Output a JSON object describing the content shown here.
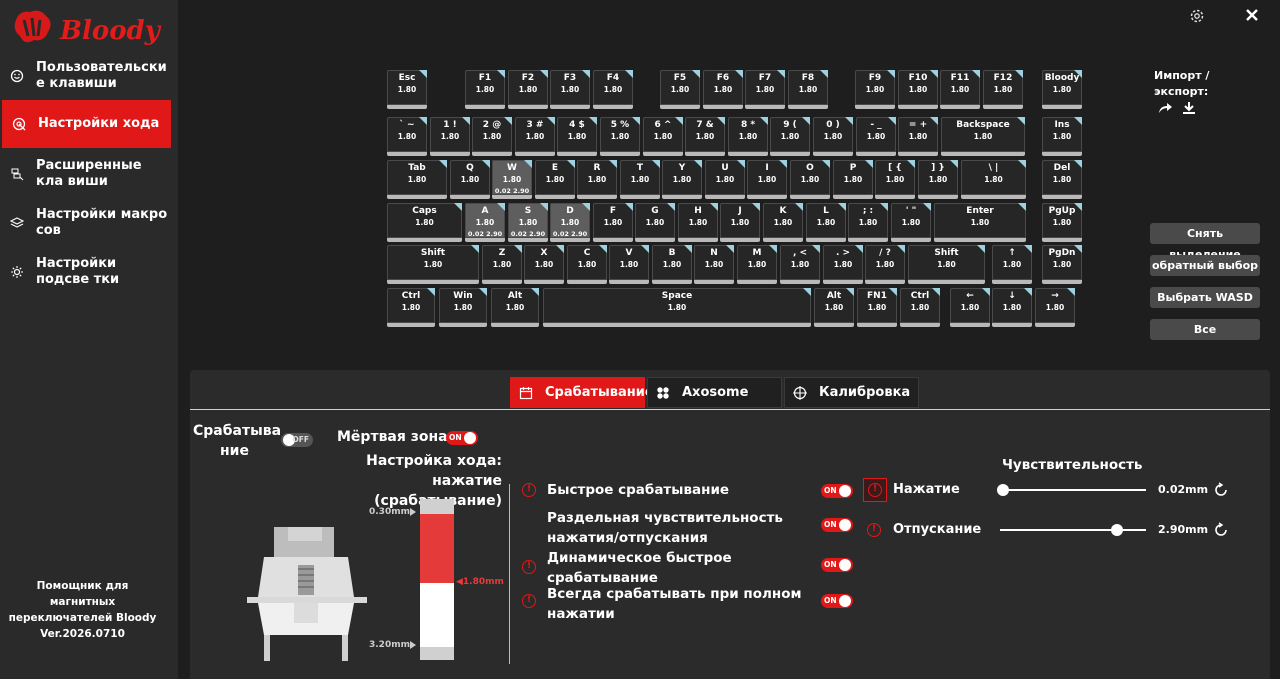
{
  "app": {
    "logo_text": "Bloody",
    "brand_color": "#e01818"
  },
  "sidebar": {
    "items": [
      {
        "label": "Пользовательски е клавиши",
        "icon": "smiley-icon"
      },
      {
        "label": "Настройки хода",
        "icon": "target-icon"
      },
      {
        "label": "Расширенные кла виши",
        "icon": "keys-icon"
      },
      {
        "label": "Настройки макро сов",
        "icon": "layers-icon"
      },
      {
        "label": "Настройки подсве тки",
        "icon": "sun-icon"
      }
    ],
    "helper": {
      "line1": "Помощник для",
      "line2": "магнитных",
      "line3": "переключателей Bloody",
      "version": "Ver.2026.0710"
    }
  },
  "window": {
    "settings_icon": "gear-icon",
    "close_icon": "close-icon"
  },
  "keyboard": {
    "default_value": "1.80",
    "rows": [
      [
        {
          "label": "Esc",
          "value": "1.80"
        },
        {
          "label": "F1",
          "value": "1.80"
        },
        {
          "label": "F2",
          "value": "1.80"
        },
        {
          "label": "F3",
          "value": "1.80"
        },
        {
          "label": "F4",
          "value": "1.80"
        },
        {
          "label": "F5",
          "value": "1.80"
        },
        {
          "label": "F6",
          "value": "1.80"
        },
        {
          "label": "F7",
          "value": "1.80"
        },
        {
          "label": "F8",
          "value": "1.80"
        },
        {
          "label": "F9",
          "value": "1.80"
        },
        {
          "label": "F10",
          "value": "1.80"
        },
        {
          "label": "F11",
          "value": "1.80"
        },
        {
          "label": "F12",
          "value": "1.80"
        },
        {
          "label": "Bloody",
          "value": "1.80"
        }
      ],
      [
        {
          "label": "` ~",
          "value": "1.80"
        },
        {
          "label": "1 !",
          "value": "1.80"
        },
        {
          "label": "2 @",
          "value": "1.80"
        },
        {
          "label": "3 #",
          "value": "1.80"
        },
        {
          "label": "4 $",
          "value": "1.80"
        },
        {
          "label": "5 %",
          "value": "1.80"
        },
        {
          "label": "6 ^",
          "value": "1.80"
        },
        {
          "label": "7 &",
          "value": "1.80"
        },
        {
          "label": "8 *",
          "value": "1.80"
        },
        {
          "label": "9 (",
          "value": "1.80"
        },
        {
          "label": "0 )",
          "value": "1.80"
        },
        {
          "label": "- _",
          "value": "1.80"
        },
        {
          "label": "= +",
          "value": "1.80"
        },
        {
          "label": "Backspace",
          "value": "1.80"
        },
        {
          "label": "Ins",
          "value": "1.80"
        }
      ],
      [
        {
          "label": "Tab",
          "value": "1.80"
        },
        {
          "label": "Q",
          "value": "1.80"
        },
        {
          "label": "W",
          "value": "1.80",
          "sub": "0.02  2.90",
          "selected": true
        },
        {
          "label": "E",
          "value": "1.80"
        },
        {
          "label": "R",
          "value": "1.80"
        },
        {
          "label": "T",
          "value": "1.80"
        },
        {
          "label": "Y",
          "value": "1.80"
        },
        {
          "label": "U",
          "value": "1.80"
        },
        {
          "label": "I",
          "value": "1.80"
        },
        {
          "label": "O",
          "value": "1.80"
        },
        {
          "label": "P",
          "value": "1.80"
        },
        {
          "label": "[ {",
          "value": "1.80"
        },
        {
          "label": "] }",
          "value": "1.80"
        },
        {
          "label": "\\ |",
          "value": "1.80"
        },
        {
          "label": "Del",
          "value": "1.80"
        }
      ],
      [
        {
          "label": "Caps",
          "value": "1.80"
        },
        {
          "label": "A",
          "value": "1.80",
          "sub": "0.02  2.90",
          "selected": true
        },
        {
          "label": "S",
          "value": "1.80",
          "sub": "0.02  2.90",
          "selected": true
        },
        {
          "label": "D",
          "value": "1.80",
          "sub": "0.02  2.90",
          "selected": true
        },
        {
          "label": "F",
          "value": "1.80"
        },
        {
          "label": "G",
          "value": "1.80"
        },
        {
          "label": "H",
          "value": "1.80"
        },
        {
          "label": "J",
          "value": "1.80"
        },
        {
          "label": "K",
          "value": "1.80"
        },
        {
          "label": "L",
          "value": "1.80"
        },
        {
          "label": "; :",
          "value": "1.80"
        },
        {
          "label": "' \"",
          "value": "1.80"
        },
        {
          "label": "Enter",
          "value": "1.80"
        },
        {
          "label": "PgUp",
          "value": "1.80"
        }
      ],
      [
        {
          "label": "Shift",
          "value": "1.80"
        },
        {
          "label": "Z",
          "value": "1.80"
        },
        {
          "label": "X",
          "value": "1.80"
        },
        {
          "label": "C",
          "value": "1.80"
        },
        {
          "label": "V",
          "value": "1.80"
        },
        {
          "label": "B",
          "value": "1.80"
        },
        {
          "label": "N",
          "value": "1.80"
        },
        {
          "label": "M",
          "value": "1.80"
        },
        {
          "label": ", <",
          "value": "1.80"
        },
        {
          "label": ". >",
          "value": "1.80"
        },
        {
          "label": "/ ?",
          "value": "1.80"
        },
        {
          "label": "Shift",
          "value": "1.80"
        },
        {
          "label": "↑",
          "value": "1.80"
        },
        {
          "label": "PgDn",
          "value": "1.80"
        }
      ],
      [
        {
          "label": "Ctrl",
          "value": "1.80"
        },
        {
          "label": "Win",
          "value": "1.80"
        },
        {
          "label": "Alt",
          "value": "1.80"
        },
        {
          "label": "Space",
          "value": "1.80"
        },
        {
          "label": "Alt",
          "value": "1.80"
        },
        {
          "label": "FN1",
          "value": "1.80"
        },
        {
          "label": "Ctrl",
          "value": "1.80"
        },
        {
          "label": "←",
          "value": "1.80"
        },
        {
          "label": "↓",
          "value": "1.80"
        },
        {
          "label": "→",
          "value": "1.80"
        }
      ]
    ]
  },
  "right_panel": {
    "import_export_line1": "Импорт /",
    "import_export_line2": "экспорт:",
    "export_icon": "share-icon",
    "import_icon": "download-icon",
    "buttons": [
      "Снять выделение",
      "обратный выбор",
      "Выбрать WASD",
      "Все"
    ]
  },
  "tabs": [
    {
      "label": "Срабатывание",
      "icon": "calendar-icon",
      "active": true
    },
    {
      "label": "Axosome",
      "icon": "clover-icon",
      "active": false
    },
    {
      "label": "Калибровка",
      "icon": "crosshair-icon",
      "active": false
    }
  ],
  "settings": {
    "actuation_label_1": "Срабатыва",
    "actuation_label_2": "ние",
    "actuation_toggle": "OFF",
    "deadzone_label": "Мёртвая зона",
    "deadzone_toggle": "ON",
    "travel_title_1": "Настройка хода: нажатие",
    "travel_title_2": "(срабатывание)",
    "travel_top": "0.30mm",
    "travel_bottom": "3.20mm",
    "travel_current": "◀1.80mm",
    "travel_range": [
      0.3,
      3.2
    ],
    "travel_value": 1.8,
    "options": [
      {
        "line1": "Быстрое срабатывание",
        "line2": "",
        "toggle": "ON",
        "warn": true
      },
      {
        "line1": "Раздельная чувствительность",
        "line2": "нажатия/отпускания",
        "toggle": "ON",
        "warn": false
      },
      {
        "line1": "Динамическое быстрое",
        "line2": "срабатывание",
        "toggle": "ON",
        "warn": true
      },
      {
        "line1": "Всегда срабатывать при полном",
        "line2": "нажатии",
        "toggle": "ON",
        "warn": true
      }
    ],
    "sensitivity_title": "Чувствительность",
    "press_label": "Нажатие",
    "press_value": "0.02mm",
    "press_fraction": 0.0,
    "release_label": "Отпускание",
    "release_value": "2.90mm",
    "release_fraction": 0.8
  }
}
